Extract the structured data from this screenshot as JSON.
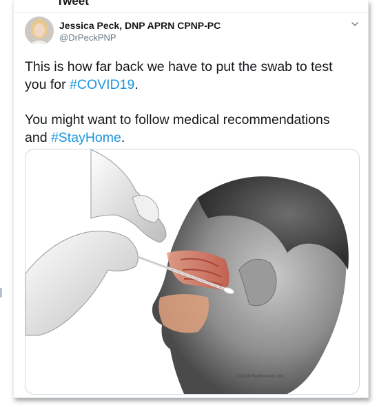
{
  "header": {
    "cut_title": "Tweet"
  },
  "tweet": {
    "author_name": "Jessica Peck, DNP APRN CPNP-PC",
    "handle": "@DrPeckPNP",
    "text_line1_before": "This is how far back we have to put the swab to test you for ",
    "hashtag1": "#COVID19",
    "text_line1_after": ".",
    "text_line2_before": "You might want to follow medical recommendations and ",
    "hashtag2": "#StayHome",
    "text_line2_after": "."
  },
  "media": {
    "copyright": "©2020 Medivisuals, Inc."
  },
  "icons": {
    "caret": "chevron-down-icon",
    "avatar": "author-avatar"
  },
  "colors": {
    "hashtag": "#1b95e0",
    "text": "#14171a",
    "muted": "#657786",
    "border": "#ccd6dd"
  }
}
